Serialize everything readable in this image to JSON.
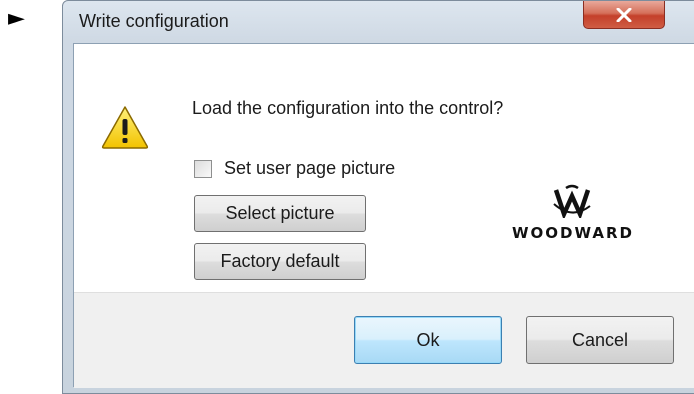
{
  "marker": {
    "glyph": "►",
    "icon": "right-pointer-icon"
  },
  "dialog": {
    "title": "Write configuration",
    "close_icon": "close-icon",
    "close_color": "#c4402a",
    "message": "Load the configuration into the control?",
    "warning_icon": "warning-icon",
    "checkbox": {
      "label": "Set user page picture",
      "checked": false
    },
    "buttons": {
      "select_picture": "Select picture",
      "factory_default": "Factory default",
      "ok": "Ok",
      "cancel": "Cancel"
    },
    "logo": {
      "icon": "woodward-logo-icon",
      "text": "WOODWARD"
    }
  }
}
